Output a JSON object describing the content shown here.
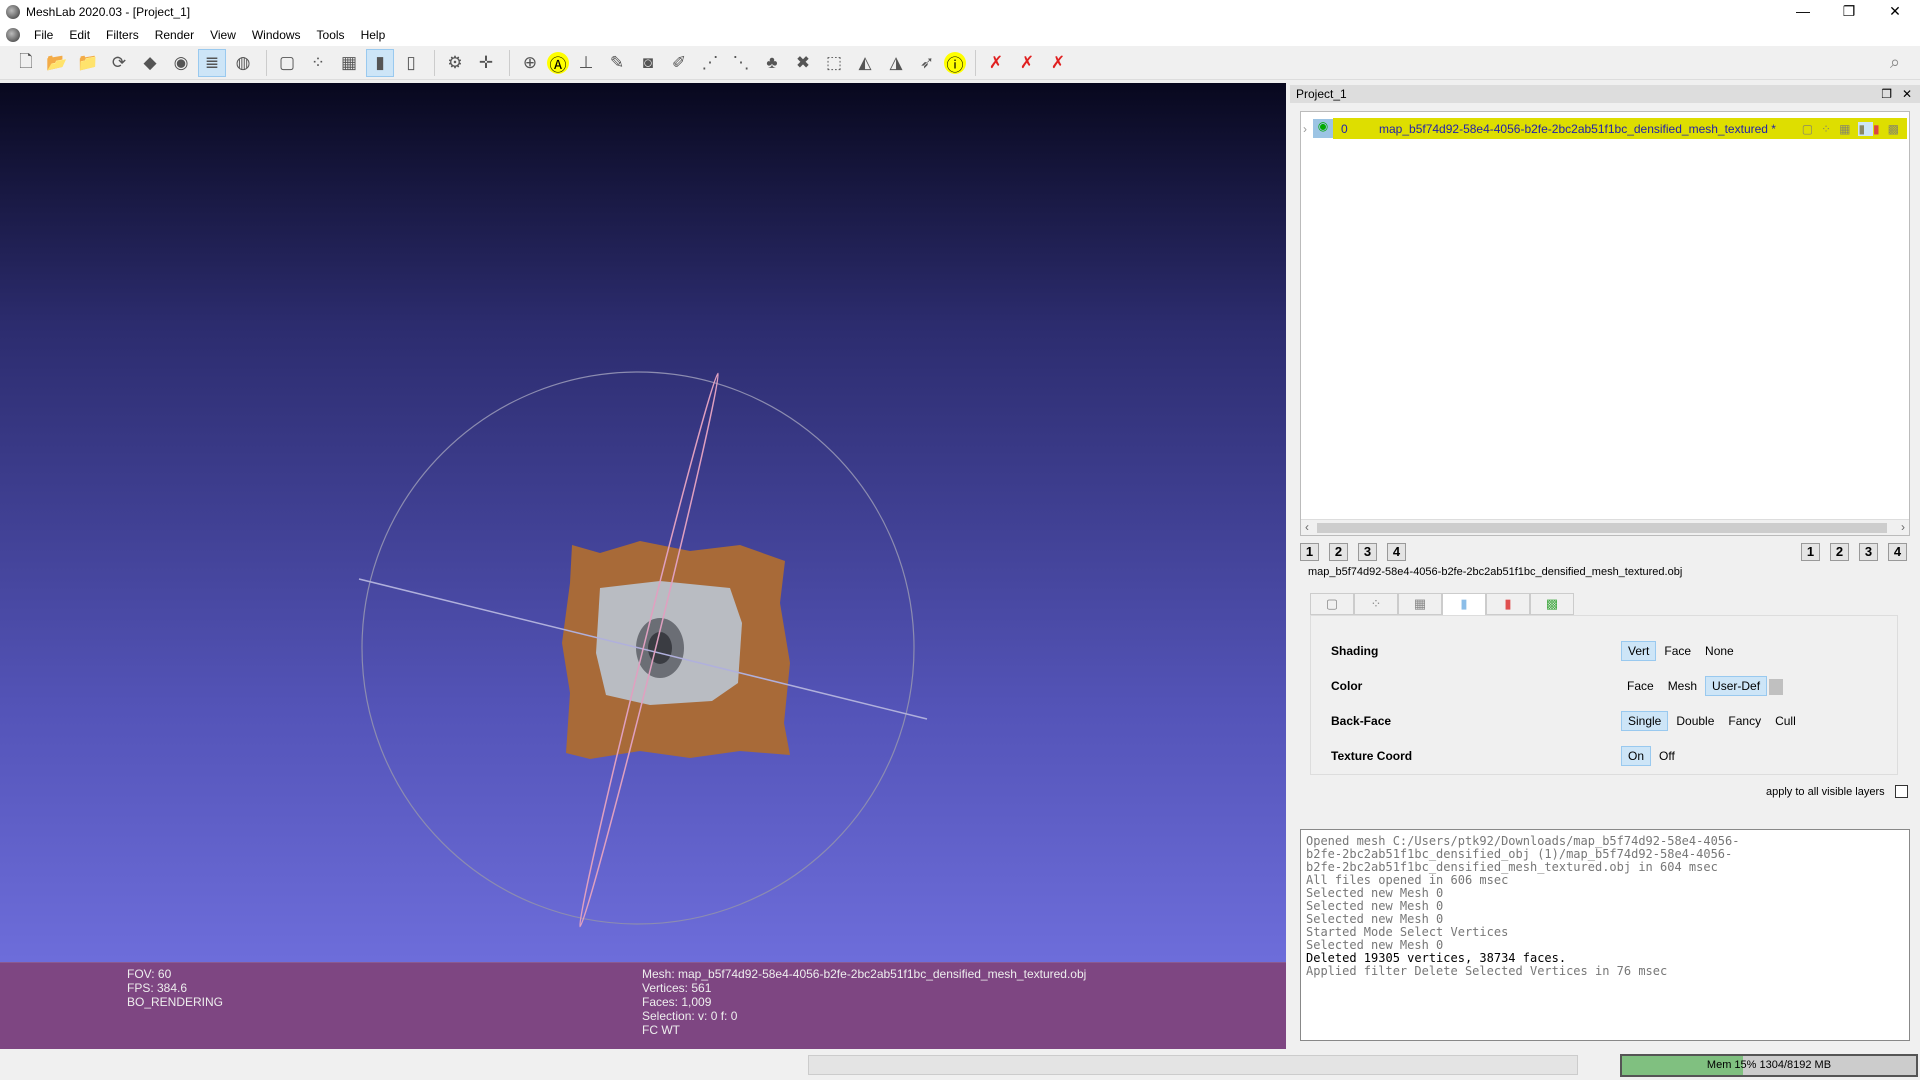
{
  "window": {
    "title": "MeshLab 2020.03 - [Project_1]",
    "minimize": "—",
    "maximize": "❐",
    "close": "✕"
  },
  "menu": [
    "File",
    "Edit",
    "Filters",
    "Render",
    "View",
    "Windows",
    "Tools",
    "Help"
  ],
  "toolbar": {
    "groups": [
      [
        {
          "icon": "new-project-icon",
          "g": "🗋"
        },
        {
          "icon": "open-project-icon",
          "g": "📂"
        },
        {
          "icon": "import-mesh-icon",
          "g": "📁"
        },
        {
          "icon": "reload-icon",
          "g": "⟳"
        },
        {
          "icon": "export-mesh-icon",
          "g": "◆"
        },
        {
          "icon": "snapshot-icon",
          "g": "◉"
        },
        {
          "icon": "layers-icon",
          "g": "≣",
          "active": true
        },
        {
          "icon": "raster-icon",
          "g": "◍"
        }
      ],
      [
        {
          "icon": "bbox-icon",
          "g": "▢"
        },
        {
          "icon": "points-icon",
          "g": "⁘"
        },
        {
          "icon": "wireframe-icon",
          "g": "▦"
        },
        {
          "icon": "smooth-icon",
          "g": "▮",
          "active": true
        },
        {
          "icon": "flat-icon",
          "g": "▯"
        }
      ],
      [
        {
          "icon": "decorations-icon",
          "g": "⚙"
        },
        {
          "icon": "axes-icon",
          "g": "✛"
        }
      ],
      [
        {
          "icon": "manipulator-icon",
          "g": "⊕"
        },
        {
          "icon": "measure-icon",
          "g": "Ⓐ"
        },
        {
          "icon": "align-icon",
          "g": "⊥"
        },
        {
          "icon": "paint-icon",
          "g": "✎"
        },
        {
          "icon": "camera-icon",
          "g": "◙"
        },
        {
          "icon": "brush-icon",
          "g": "✐"
        },
        {
          "icon": "select-vertices-icon",
          "g": "⋰"
        },
        {
          "icon": "select-connected-icon",
          "g": "⋱"
        },
        {
          "icon": "color-paint-icon",
          "g": "♣"
        },
        {
          "icon": "georef-icon",
          "g": "✖"
        },
        {
          "icon": "select-faces-icon",
          "g": "⬚"
        },
        {
          "icon": "select-faces-plus-icon",
          "g": "◭"
        },
        {
          "icon": "select-faces-minus-icon",
          "g": "◮"
        },
        {
          "icon": "select-cursor-icon",
          "g": "➶"
        },
        {
          "icon": "info-icon",
          "g": "ⓘ"
        }
      ],
      [
        {
          "icon": "delete-vertices-icon",
          "g": "✗"
        },
        {
          "icon": "delete-faces-icon",
          "g": "✗"
        },
        {
          "icon": "delete-faces-vertices-icon",
          "g": "✗"
        }
      ]
    ]
  },
  "viewport": {
    "fov": "FOV: 60",
    "fps": "FPS:   384.6",
    "mode": "BO_RENDERING",
    "mesh": "Mesh: map_b5f74d92-58e4-4056-b2fe-2bc2ab51f1bc_densified_mesh_textured.obj",
    "vertices": "Vertices: 561",
    "faces": "Faces: 1,009",
    "selection": "Selection: v: 0 f: 0",
    "flags": "FC WT"
  },
  "panel": {
    "title": "Project_1",
    "layer": {
      "index": "0",
      "name": "map_b5f74d92-58e4-4056-b2fe-2bc2ab51f1bc_densified_mesh_textured *"
    },
    "left_buttons": [
      "1",
      "2",
      "3",
      "4"
    ],
    "right_buttons": [
      "1",
      "2",
      "3",
      "4"
    ],
    "filename": "map_b5f74d92-58e4-4056-b2fe-2bc2ab51f1bc_densified_mesh_textured.obj",
    "render": {
      "shading": {
        "label": "Shading",
        "options": [
          "Vert",
          "Face",
          "None"
        ],
        "selected": "Vert"
      },
      "color": {
        "label": "Color",
        "options": [
          "Face",
          "Mesh",
          "User-Def"
        ],
        "selected": "User-Def"
      },
      "backface": {
        "label": "Back-Face",
        "options": [
          "Single",
          "Double",
          "Fancy",
          "Cull"
        ],
        "selected": "Single"
      },
      "texcoord": {
        "label": "Texture Coord",
        "options": [
          "On",
          "Off"
        ],
        "selected": "On"
      }
    },
    "apply_all": "apply to all visible layers"
  },
  "log": [
    "Opened mesh C:/Users/ptk92/Downloads/map_b5f74d92-58e4-4056-",
    "b2fe-2bc2ab51f1bc_densified_obj (1)/map_b5f74d92-58e4-4056-",
    "b2fe-2bc2ab51f1bc_densified_mesh_textured.obj in 604 msec",
    "All files opened in 606 msec",
    "Selected new Mesh 0",
    "Selected new Mesh 0",
    "Selected new Mesh 0",
    "Started Mode Select Vertices",
    "Selected new Mesh 0",
    "Deleted 19305 vertices, 38734 faces.",
    "Applied filter Delete Selected Vertices in 76 msec"
  ],
  "log_highlight": 9,
  "status": {
    "mem": "Mem 15% 1304/8192 MB",
    "mem_fraction": 0.15
  },
  "colors": {
    "layer_bg": "#dede00",
    "mem_fill": "#80c080",
    "info_bg": "#7e4682"
  }
}
